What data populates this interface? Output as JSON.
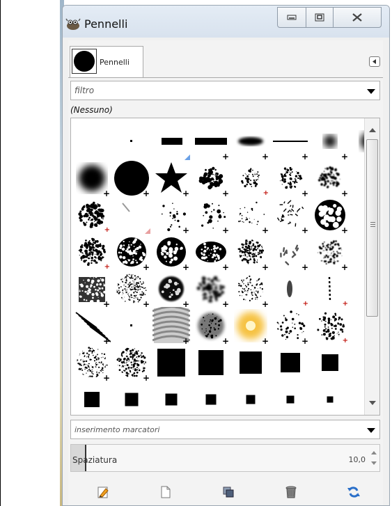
{
  "window": {
    "title": "Pennelli",
    "app_icon": "gimp-wilber-icon",
    "controls": [
      "minimize-icon",
      "maximize-icon",
      "close-icon"
    ]
  },
  "dock": {
    "tab_label": "Pennelli",
    "tab_menu_icon": "tab-menu-arrow-icon"
  },
  "filter": {
    "placeholder": "filtro"
  },
  "current_tag": "(Nessuno)",
  "tag_entry": {
    "placeholder": "inserimento marcatori"
  },
  "spacing": {
    "label": "Spaziatura",
    "value": "10,0",
    "fraction": 0.05
  },
  "colors": {
    "title_bar": "#dde6f0",
    "panel": "#f0f0f0",
    "marker_blue": "#6aa0e6",
    "marker_red": "#c2160f"
  },
  "brush_rows": [
    [
      {
        "shape": "blank",
        "mark": "none"
      },
      {
        "shape": "pixel",
        "mark": "none"
      },
      {
        "shape": "block-small",
        "mark": "tri-blue"
      },
      {
        "shape": "hbar",
        "mark": "plus"
      },
      {
        "shape": "ellipse",
        "mark": "plus"
      },
      {
        "shape": "hline",
        "mark": "plus"
      },
      {
        "shape": "fuzzy-small",
        "mark": "plus"
      },
      {
        "shape": "fuzzy-medium",
        "mark": "plus"
      }
    ],
    [
      {
        "shape": "fuzzy-large",
        "mark": "plus"
      },
      {
        "shape": "circle",
        "mark": "plus"
      },
      {
        "shape": "star",
        "mark": "plus"
      },
      {
        "shape": "splatter",
        "mark": "plus"
      },
      {
        "shape": "splatter-sparse",
        "mark": "plus-red"
      },
      {
        "shape": "grass",
        "mark": "plus"
      },
      {
        "shape": "texture-soft",
        "mark": "plus"
      },
      {
        "shape": "blank",
        "mark": "none"
      }
    ],
    [
      {
        "shape": "sponge",
        "mark": "plus-red"
      },
      {
        "shape": "stroke",
        "mark": "tri-red"
      },
      {
        "shape": "scatter",
        "mark": "plus"
      },
      {
        "shape": "dots",
        "mark": "plus"
      },
      {
        "shape": "dots-sparse",
        "mark": "plus"
      },
      {
        "shape": "cracks",
        "mark": "plus"
      },
      {
        "shape": "cells",
        "mark": "plus"
      },
      {
        "shape": "blank",
        "mark": "none"
      }
    ],
    [
      {
        "shape": "chalk",
        "mark": "plus-red"
      },
      {
        "shape": "rough",
        "mark": "plus"
      },
      {
        "shape": "rock",
        "mark": "plus"
      },
      {
        "shape": "bark",
        "mark": "plus"
      },
      {
        "shape": "canvas",
        "mark": "plus"
      },
      {
        "shape": "sticks",
        "mark": "plus"
      },
      {
        "shape": "feathery",
        "mark": "plus"
      },
      {
        "shape": "blank",
        "mark": "none"
      }
    ],
    [
      {
        "shape": "charcoal",
        "mark": "plus"
      },
      {
        "shape": "pepper",
        "mark": "plus"
      },
      {
        "shape": "oil",
        "mark": "plus"
      },
      {
        "shape": "watercolor",
        "mark": "plus"
      },
      {
        "shape": "dry",
        "mark": "plus"
      },
      {
        "shape": "leaf",
        "mark": "plus-red"
      },
      {
        "shape": "vine",
        "mark": "plus-red"
      },
      {
        "shape": "blank",
        "mark": "none"
      }
    ],
    [
      {
        "shape": "diagonal",
        "mark": "plus"
      },
      {
        "shape": "pixel",
        "mark": "none"
      },
      {
        "shape": "hair",
        "mark": "plus"
      },
      {
        "shape": "cloud",
        "mark": "plus"
      },
      {
        "shape": "sun",
        "mark": "plus"
      },
      {
        "shape": "dust",
        "mark": "plus"
      },
      {
        "shape": "grit",
        "mark": "plus-red"
      },
      {
        "shape": "blank",
        "mark": "none"
      }
    ],
    [
      {
        "shape": "speckle",
        "mark": "plus"
      },
      {
        "shape": "gravel",
        "mark": "plus"
      },
      {
        "shape": "square-40",
        "mark": "none"
      },
      {
        "shape": "square-36",
        "mark": "none"
      },
      {
        "shape": "square-32",
        "mark": "none"
      },
      {
        "shape": "square-28",
        "mark": "none"
      },
      {
        "shape": "square-24",
        "mark": "none"
      },
      {
        "shape": "blank",
        "mark": "none"
      }
    ],
    [
      {
        "shape": "square-22",
        "mark": "none"
      },
      {
        "shape": "square-19",
        "mark": "none"
      },
      {
        "shape": "square-17",
        "mark": "none"
      },
      {
        "shape": "square-15",
        "mark": "none"
      },
      {
        "shape": "square-13",
        "mark": "none"
      },
      {
        "shape": "square-11",
        "mark": "none"
      },
      {
        "shape": "square-9",
        "mark": "none"
      },
      {
        "shape": "blank",
        "mark": "none"
      }
    ]
  ],
  "button_bar": [
    {
      "name": "edit-brush-button",
      "icon": "edit-pencil-icon"
    },
    {
      "name": "new-brush-button",
      "icon": "new-document-icon"
    },
    {
      "name": "duplicate-brush-button",
      "icon": "duplicate-icon"
    },
    {
      "name": "delete-brush-button",
      "icon": "trash-icon"
    },
    {
      "name": "refresh-brushes-button",
      "icon": "refresh-icon"
    }
  ]
}
